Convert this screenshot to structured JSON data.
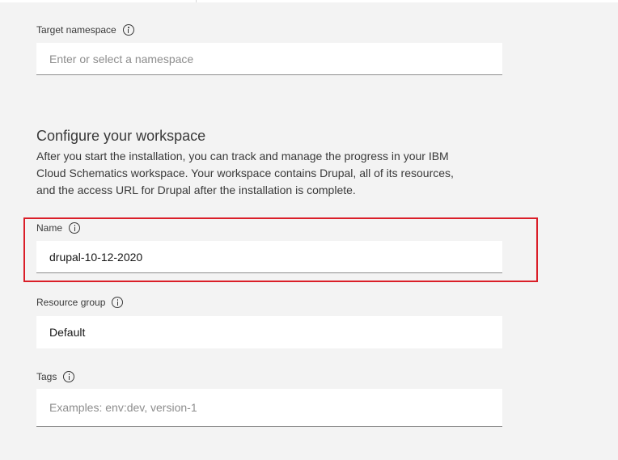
{
  "target_namespace": {
    "label": "Target namespace",
    "value": "",
    "placeholder": "Enter or select a namespace"
  },
  "workspace": {
    "title": "Configure your workspace",
    "description": "After you start the installation, you can track and manage the progress in your IBM Cloud Schematics workspace. Your workspace contains Drupal, all of its resources, and the access URL for Drupal after the installation is complete."
  },
  "name_field": {
    "label": "Name",
    "value": "drupal-10-12-2020",
    "placeholder": ""
  },
  "resource_group": {
    "label": "Resource group",
    "value": "Default",
    "placeholder": ""
  },
  "tags": {
    "label": "Tags",
    "value": "",
    "placeholder": "Examples: env:dev, version-1"
  },
  "colors": {
    "background": "#f3f3f3",
    "field_background": "#ffffff",
    "highlight": "#da1e28",
    "placeholder": "#8d8d8d"
  }
}
